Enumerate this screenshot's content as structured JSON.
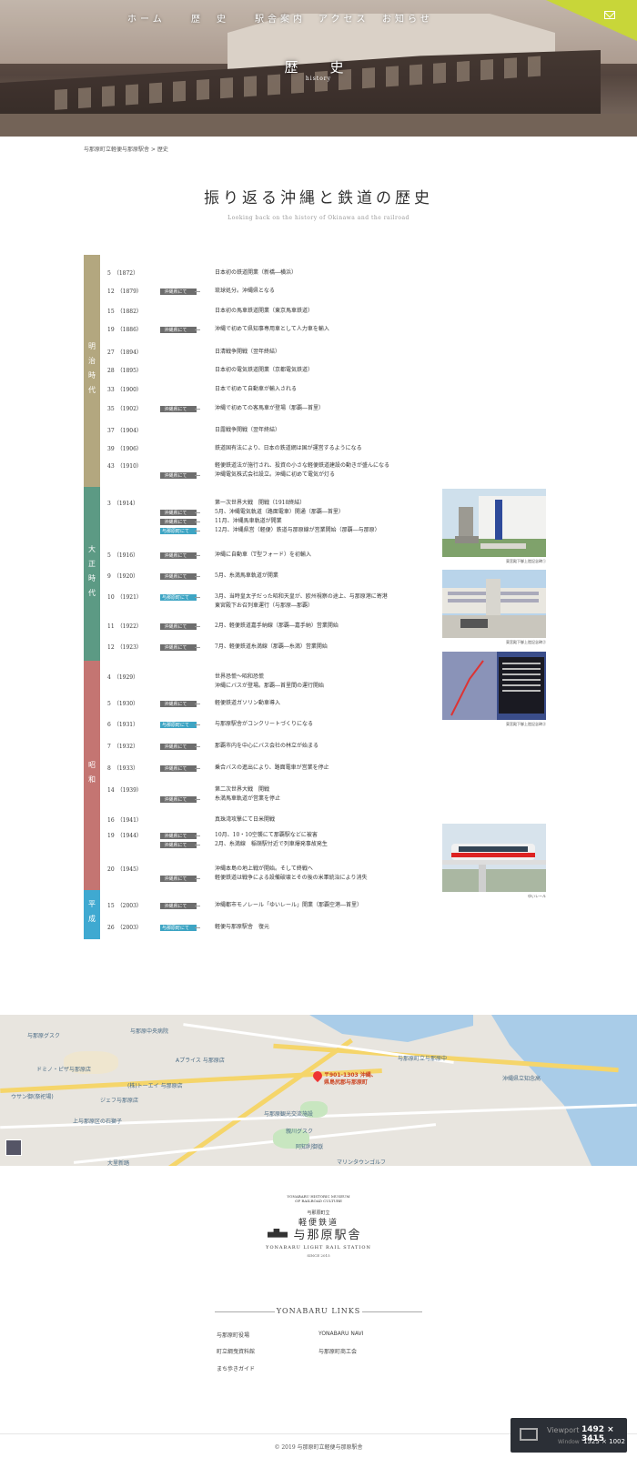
{
  "nav": [
    "ホーム",
    "歴　史",
    "駅舎案内",
    "アクセス",
    "お知らせ"
  ],
  "hero": {
    "title": "歴　史",
    "subtitle": "history"
  },
  "breadcrumb": "与那原町立軽便与那原駅舎 > 歴史",
  "section": {
    "title": "振り返る沖縄と鉄道の歴史",
    "subtitle": "Looking back on the history of Okinawa and the railroad"
  },
  "colors": {
    "meiji": "#b3a77f",
    "taisho": "#5c9a84",
    "showa": "#c47572",
    "heisei": "#3fa9d1",
    "tag_gray": "#6d6d6d",
    "tag_blue": "#3ea5c4"
  },
  "eras": [
    {
      "label": "明治時代",
      "color": "#b3a77f"
    },
    {
      "label": "大正時代",
      "color": "#5c9a84"
    },
    {
      "label": "昭和",
      "color": "#c47572"
    },
    {
      "label": "平成",
      "color": "#3fa9d1"
    }
  ],
  "tags": {
    "okinawa": "沖縄県にて",
    "yonabaru": "与那原町にて"
  },
  "timeline": [
    {
      "year": "5　（1872）",
      "events": [
        {
          "text": "日本初の鉄道開業（新橋―横浜）"
        }
      ]
    },
    {
      "year": "12　（1879）",
      "events": [
        {
          "tag": "okinawa",
          "text": "琉球処分。沖縄県となる"
        }
      ]
    },
    {
      "year": "15　（1882）",
      "events": [
        {
          "text": "日本初の馬車鉄道開業（東京馬車鉄道）"
        }
      ]
    },
    {
      "year": "19　（1886）",
      "events": [
        {
          "tag": "okinawa",
          "text": "沖縄で初めて県知事専用車として人力車を輸入"
        }
      ]
    },
    {
      "year": "27　（1894）",
      "events": [
        {
          "text": "日清戦争開戦（翌年終結）"
        }
      ]
    },
    {
      "year": "28　（1895）",
      "events": [
        {
          "text": "日本初の電気鉄道開業（京都電気鉄道）"
        }
      ]
    },
    {
      "year": "33　（1900）",
      "events": [
        {
          "text": "日本で初めて自動車が輸入される"
        }
      ]
    },
    {
      "year": "35　（1902）",
      "events": [
        {
          "tag": "okinawa",
          "text": "沖縄で初めての客馬車が登場（那覇―首里）"
        }
      ]
    },
    {
      "year": "37　（1904）",
      "events": [
        {
          "text": "日露戦争開戦（翌年終結）"
        }
      ]
    },
    {
      "year": "39　（1906）",
      "events": [
        {
          "text": "鉄道国有法により、日本の鉄道網は国が運営するようになる"
        }
      ]
    },
    {
      "year": "43　（1910）",
      "events": [
        {
          "text": "軽便鉄道法が施行され、投資の小さな軽便鉄道建設の動きが盛んになる"
        },
        {
          "tag": "okinawa",
          "text": "沖縄電気株式会社設立。沖縄に初めて電気が灯る"
        }
      ]
    },
    {
      "year": "3　（1914）",
      "events": [
        {
          "text": "第一次世界大戦　開戦（1918終結）"
        },
        {
          "tag": "okinawa",
          "text": "5月、沖縄電気軌道（路面電車）開通（那覇―首里）"
        },
        {
          "tag": "okinawa",
          "text": "11月、沖縄馬車軌道が開業"
        },
        {
          "tag": "yonabaru",
          "text": "12月、沖縄県営（軽便）鉄道与那原線が営業開始（那覇―与那原）"
        }
      ]
    },
    {
      "year": "5　（1916）",
      "events": [
        {
          "tag": "okinawa",
          "text": "沖縄に自動車（T型フォード）を初輸入"
        }
      ]
    },
    {
      "year": "9　（1920）",
      "events": [
        {
          "tag": "okinawa",
          "text": "5月、糸満馬車軌道が開業"
        }
      ]
    },
    {
      "year": "10　（1921）",
      "events": [
        {
          "tag": "yonabaru",
          "text": "3月、当時皇太子だった昭和天皇が、欧州視察の途上、与那原港に寄港"
        },
        {
          "text": "東宮殿下お召列車運行（与那原―那覇）"
        }
      ]
    },
    {
      "year": "11　（1922）",
      "events": [
        {
          "tag": "okinawa",
          "text": "2月、軽便鉄道嘉手納線（那覇―嘉手納）営業開始"
        }
      ]
    },
    {
      "year": "12　（1923）",
      "events": [
        {
          "tag": "okinawa",
          "text": "7月、軽便鉄道糸満線（那覇―糸満）営業開始"
        }
      ]
    },
    {
      "year": "4　（1929）",
      "events": [
        {
          "text": "世界恐慌～昭和恐慌"
        },
        {
          "text": "沖縄にバスが登場。那覇―首里間の運行開始"
        }
      ]
    },
    {
      "year": "5　（1930）",
      "events": [
        {
          "tag": "okinawa",
          "text": "軽便鉄道ガソリン動車導入"
        }
      ]
    },
    {
      "year": "6　（1931）",
      "events": [
        {
          "tag": "yonabaru",
          "text": "与那原駅舎がコンクリートづくりになる"
        }
      ]
    },
    {
      "year": "7　（1932）",
      "events": [
        {
          "tag": "okinawa",
          "text": "那覇市内を中心にバス会社の林立が始まる"
        }
      ]
    },
    {
      "year": "8　（1933）",
      "events": [
        {
          "tag": "okinawa",
          "text": "乗合バスの進出により、路面電車が営業を停止"
        }
      ]
    },
    {
      "year": "14　（1939）",
      "events": [
        {
          "text": "第二次世界大戦　開戦"
        },
        {
          "tag": "okinawa",
          "text": "糸満馬車軌道が営業を停止"
        }
      ]
    },
    {
      "year": "16　（1941）",
      "events": [
        {
          "text": "真珠湾攻撃にて日米開戦"
        }
      ]
    },
    {
      "year": "19　（1944）",
      "events": [
        {
          "tag": "okinawa",
          "text": "10月、10・10空襲にて那覇駅などに被害"
        },
        {
          "tag": "okinawa",
          "text": "2月、糸満線　稲嶺駅付近で列車爆発事故発生"
        }
      ]
    },
    {
      "year": "20　（1945）",
      "events": [
        {
          "text": "沖縄本島の地上戦が開始。そして終戦へ"
        },
        {
          "tag": "okinawa",
          "text": "軽便鉄道は戦争による設備破壊とその後の米軍統治により消失"
        }
      ]
    },
    {
      "year": "15　（2003）",
      "events": [
        {
          "tag": "okinawa",
          "text": "沖縄都市モノレール「ゆいレール」開業（那覇空港―首里）"
        }
      ]
    },
    {
      "year": "26　（2003）",
      "events": [
        {
          "tag": "yonabaru",
          "text": "軽便与那原駅舎　復元"
        }
      ]
    }
  ],
  "photos": [
    {
      "caption": "東宮殿下御上陸記念碑①",
      "icon": "monument-photo"
    },
    {
      "caption": "東宮殿下御上陸記念碑②",
      "icon": "monument-photo"
    },
    {
      "caption": "東宮殿下御上陸記念碑③",
      "icon": "monument-photo"
    },
    {
      "caption": "ゆいレール",
      "icon": "monorail-photo"
    }
  ],
  "map": {
    "pin_label": "〒901-1303 沖縄、\n県島尻郡与那原町",
    "labels": [
      "与那原グスク",
      "与那原中央病院",
      "ドミノ・ピザ与那原店",
      "Aプライス 与那原店",
      "与那原町立与那原中",
      "沖縄県立知念高",
      "(株)トーエイ 与那原店",
      "ジェフ与那原店",
      "上与那原区の石獅子",
      "ウサン御(祭祀場)",
      "大里新踏",
      "マリンタウンゴルフ",
      "阿知利御嶽",
      "親川グスク",
      "与那原観光交流施設"
    ]
  },
  "logo": {
    "arc": "YONABARU HISTORIC MUSEUM OF RAILROAD CULTURE",
    "l1": "与那原町立",
    "l2": "軽便鉄道",
    "l3": "与那原駅舎",
    "l4": "YONABARU LIGHT RAIL STATION",
    "l5": "SINCE 2015"
  },
  "links": {
    "title": "YONABARU LINKS",
    "items": [
      "与那原町役場",
      "YONABARU NAVI",
      "町立綱曳資料館",
      "与那原町商工会",
      "まち歩きガイド"
    ]
  },
  "copyright": "© 2019 与那原町立軽便与那原駅舎",
  "viewport": {
    "label1": "Viewport",
    "value1": "1492 × 3415",
    "label2": "Window",
    "value2": "1525 × 1002"
  }
}
